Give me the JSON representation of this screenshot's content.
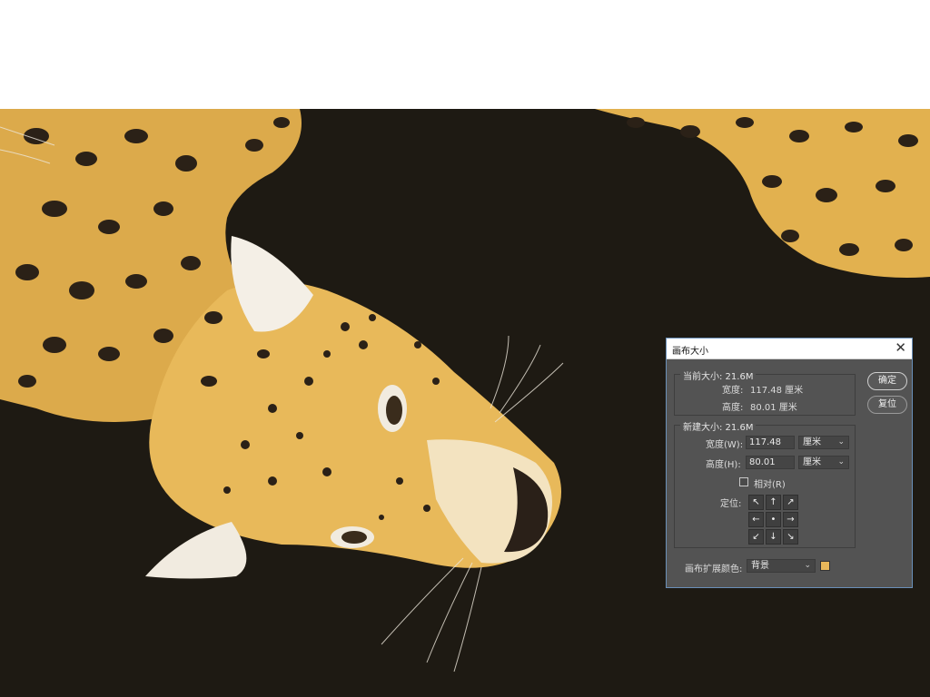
{
  "dialog": {
    "title": "画布大小",
    "close_glyph": "✕",
    "current_size": {
      "legend": "当前大小: 21.6M",
      "width_label": "宽度:",
      "width_value": "117.48 厘米",
      "height_label": "高度:",
      "height_value": "80.01 厘米"
    },
    "new_size": {
      "legend": "新建大小: 21.6M",
      "width_label": "宽度(W):",
      "width_value": "117.48",
      "width_unit": "厘米",
      "height_label": "高度(H):",
      "height_value": "80.01",
      "height_unit": "厘米",
      "relative_label": "相对(R)",
      "relative_checked": false,
      "anchor_label": "定位:",
      "anchor_glyphs": [
        "↖",
        "↑",
        "↗",
        "←",
        "•",
        "→",
        "↙",
        "↓",
        "↘"
      ]
    },
    "extension_color": {
      "label": "画布扩展颜色:",
      "value": "背景",
      "swatch_color": "#e8b75a"
    },
    "buttons": {
      "ok": "确定",
      "reset": "复位"
    }
  },
  "colors": {
    "canvas_bg": "#1e1a13",
    "fur": "#e2b14f",
    "dialog_bg": "#535353"
  }
}
